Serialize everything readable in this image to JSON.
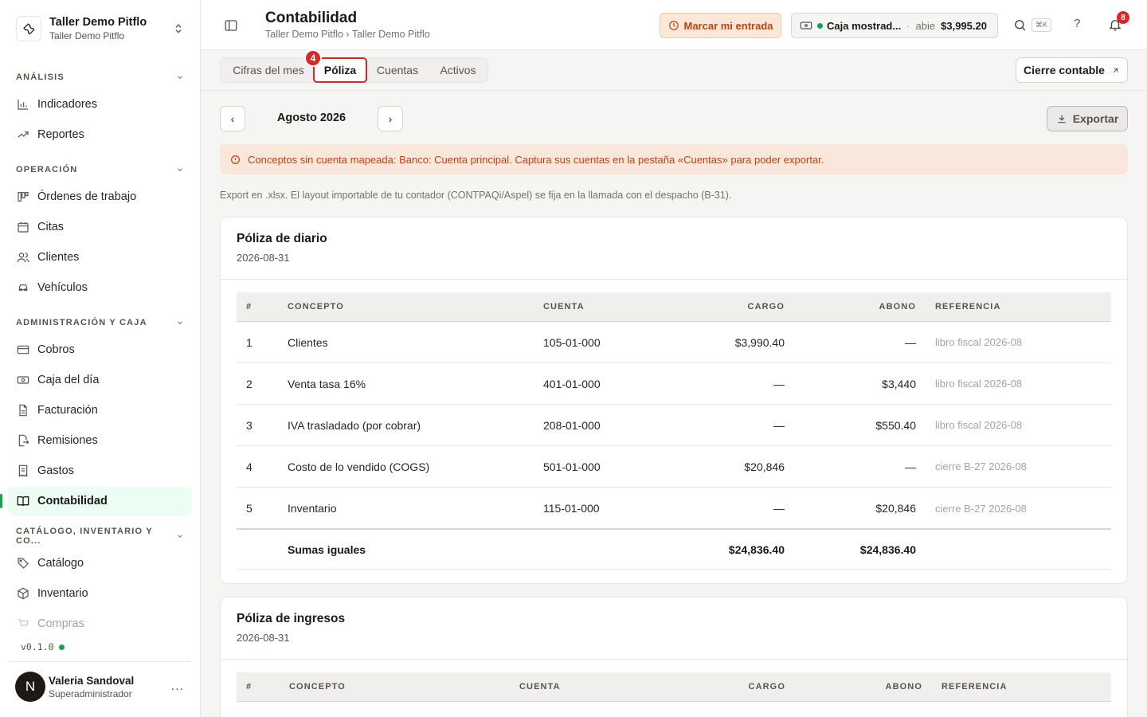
{
  "org": {
    "name": "Taller Demo Pitflo",
    "subtitle": "Taller Demo Pitflo"
  },
  "sections": [
    {
      "label": "ANÁLISIS",
      "items": [
        "Indicadores",
        "Reportes"
      ]
    },
    {
      "label": "OPERACIÓN",
      "items": [
        "Órdenes de trabajo",
        "Citas",
        "Clientes",
        "Vehículos"
      ]
    },
    {
      "label": "ADMINISTRACIÓN Y CAJA",
      "items": [
        "Cobros",
        "Caja del día",
        "Facturación",
        "Remisiones",
        "Gastos",
        "Contabilidad"
      ]
    },
    {
      "label": "CATÁLOGO, INVENTARIO Y CO...",
      "items": [
        "Catálogo",
        "Inventario",
        "Compras"
      ]
    }
  ],
  "version": "v0.1.0",
  "user": {
    "initial": "N",
    "name": "Valeria Sandoval",
    "role": "Superadministrador",
    "more": "..."
  },
  "header": {
    "title": "Contabilidad",
    "breadcrumb": "Taller Demo Pitflo › Taller Demo Pitflo",
    "punch_label": "Marcar mi entrada",
    "cash": {
      "name": "Caja mostrad...",
      "separator": "·",
      "state": "abie",
      "amount": "$3,995.20"
    },
    "shortcut": "⌘K",
    "help": "?",
    "notifications": "8"
  },
  "tabs": [
    "Cifras del mes",
    "Póliza",
    "Cuentas",
    "Activos"
  ],
  "active_tab": "Póliza",
  "step_badge": "4",
  "close_button": "Cierre contable",
  "period": {
    "prev": "‹",
    "label": "Agosto 2026",
    "next": "›"
  },
  "export_label": "Exportar",
  "warning": "Conceptos sin cuenta mapeada: Banco: Cuenta principal. Captura sus cuentas en la pestaña «Cuentas» para poder exportar.",
  "note": "Export en .xlsx. El layout importable de tu contador (CONTPAQi/Aspel) se fija en la llamada con el despacho (B-31).",
  "columns": [
    "#",
    "CONCEPTO",
    "CUENTA",
    "CARGO",
    "ABONO",
    "REFERENCIA"
  ],
  "polizas": [
    {
      "title": "Póliza de diario",
      "date": "2026-08-31",
      "rows": [
        {
          "n": "1",
          "concepto": "Clientes",
          "cuenta": "105-01-000",
          "cargo": "$3,990.40",
          "abono": "—",
          "ref": "libro fiscal 2026-08"
        },
        {
          "n": "2",
          "concepto": "Venta tasa 16%",
          "cuenta": "401-01-000",
          "cargo": "—",
          "abono": "$3,440",
          "ref": "libro fiscal 2026-08"
        },
        {
          "n": "3",
          "concepto": "IVA trasladado (por cobrar)",
          "cuenta": "208-01-000",
          "cargo": "—",
          "abono": "$550.40",
          "ref": "libro fiscal 2026-08"
        },
        {
          "n": "4",
          "concepto": "Costo de lo vendido (COGS)",
          "cuenta": "501-01-000",
          "cargo": "$20,846",
          "abono": "—",
          "ref": "cierre B-27 2026-08"
        },
        {
          "n": "5",
          "concepto": "Inventario",
          "cuenta": "115-01-000",
          "cargo": "—",
          "abono": "$20,846",
          "ref": "cierre B-27 2026-08"
        }
      ],
      "totals": {
        "label": "Sumas iguales",
        "cargo": "$24,836.40",
        "abono": "$24,836.40"
      }
    },
    {
      "title": "Póliza de ingresos",
      "date": "2026-08-31"
    }
  ],
  "colors": {
    "accent": "#16a34a",
    "danger": "#dc2626",
    "warning_text": "#c2410c",
    "warning_bg": "#f9e7dc"
  }
}
